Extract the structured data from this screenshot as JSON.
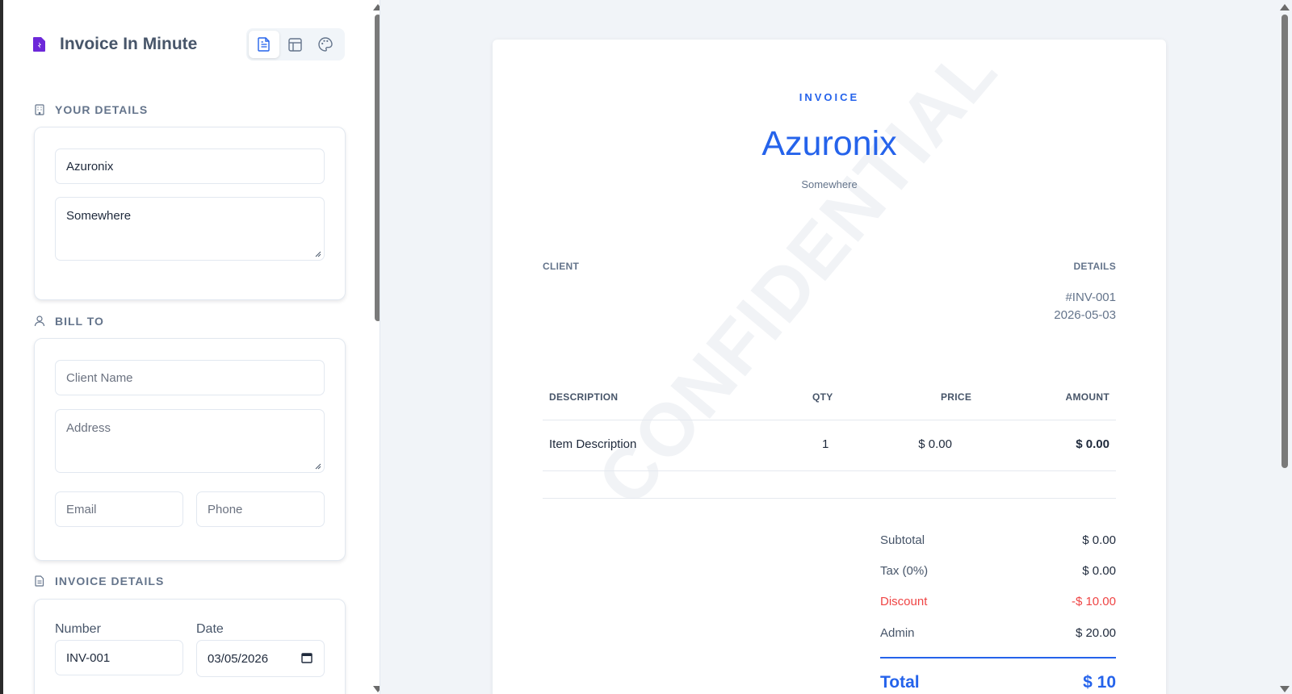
{
  "app": {
    "title": "Invoice In Minute",
    "accent_color": "#2563eb",
    "logo_color": "#6d28d9",
    "modes": [
      {
        "icon": "file-text-icon",
        "active": true
      },
      {
        "icon": "layout-icon",
        "active": false
      },
      {
        "icon": "palette-icon",
        "active": false
      }
    ]
  },
  "sidebar": {
    "your_details": {
      "label": "YOUR DETAILS",
      "icon": "building-icon",
      "company_value": "Azuronix",
      "address_value": "Somewhere"
    },
    "bill_to": {
      "label": "BILL TO",
      "icon": "user-icon",
      "client_placeholder": "Client Name",
      "address_placeholder": "Address",
      "email_placeholder": "Email",
      "phone_placeholder": "Phone"
    },
    "invoice_details": {
      "label": "INVOICE DETAILS",
      "icon": "file-icon",
      "number_caption": "Number",
      "number_value": "INV-001",
      "date_caption": "Date",
      "date_value": "03/05/2026"
    }
  },
  "invoice": {
    "doc_label": "INVOICE",
    "company": "Azuronix",
    "address": "Somewhere",
    "client_heading": "CLIENT",
    "details_heading": "DETAILS",
    "number": "#INV-001",
    "date": "2026-05-03",
    "watermark": "CONFIDENTIAL",
    "columns": {
      "description": "DESCRIPTION",
      "qty": "QTY",
      "price": "PRICE",
      "amount": "AMOUNT"
    },
    "items": [
      {
        "description": "Item Description",
        "qty": "1",
        "price": "$ 0.00",
        "amount": "$ 0.00"
      }
    ],
    "totals": {
      "subtotal_label": "Subtotal",
      "subtotal_value": "$ 0.00",
      "tax_label": "Tax (0%)",
      "tax_value": "$ 0.00",
      "discount_label": "Discount",
      "discount_value": "-$ 10.00",
      "admin_label": "Admin",
      "admin_value": "$ 20.00",
      "total_label": "Total",
      "total_value": "$ 10"
    },
    "discount_color": "#ef4444"
  }
}
